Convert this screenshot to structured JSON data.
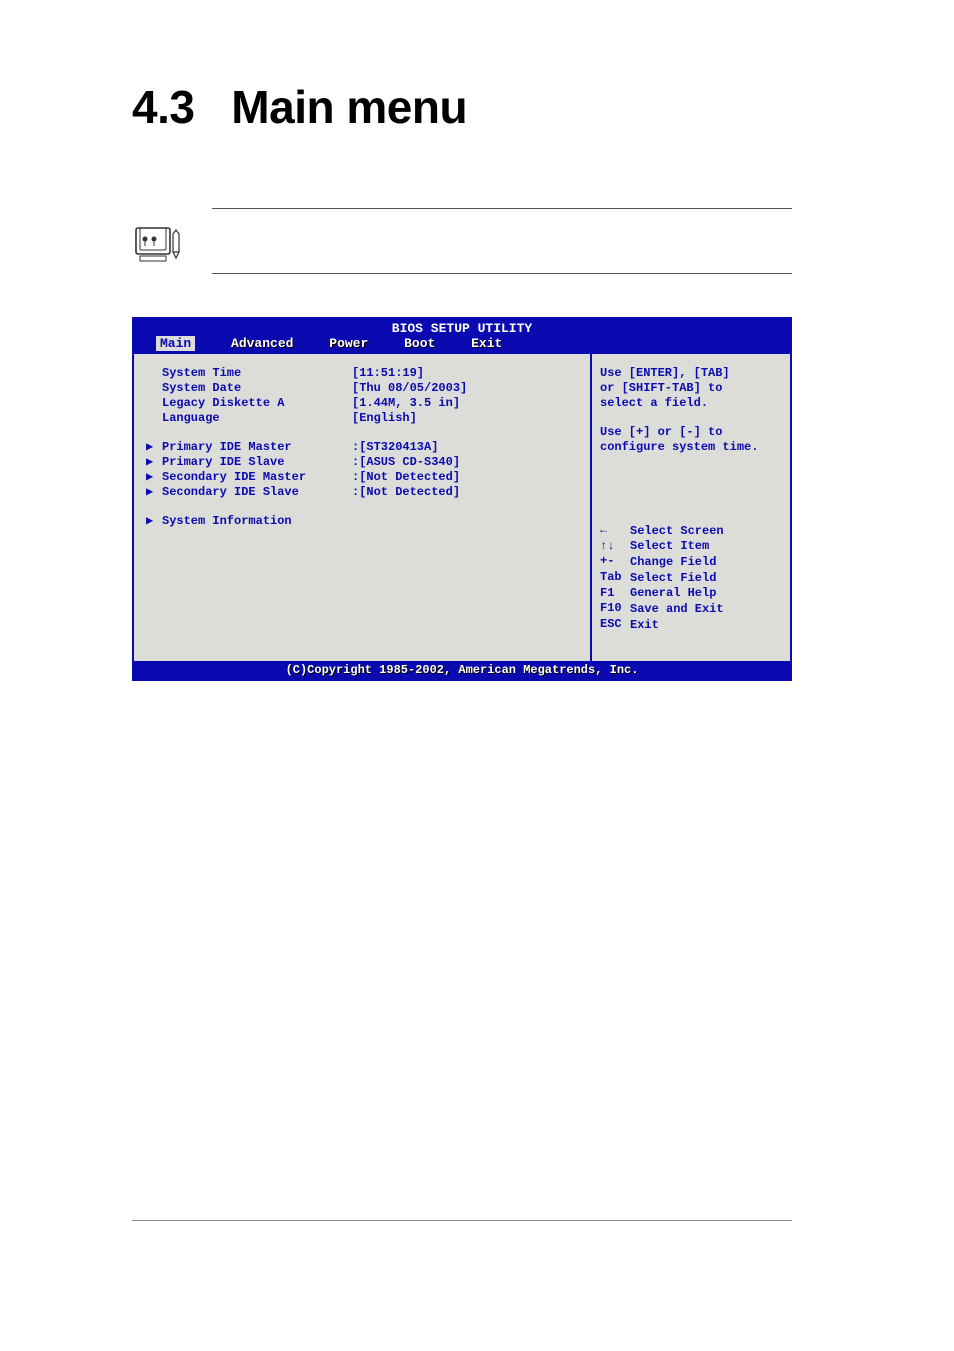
{
  "page": {
    "section_number": "4.3",
    "section_title": "Main menu"
  },
  "bios": {
    "title": "BIOS SETUP UTILITY",
    "tabs": [
      "Main",
      "Advanced",
      "Power",
      "Boot",
      "Exit"
    ],
    "selected_tab_index": 0,
    "fields": {
      "system_time": {
        "label": "System Time",
        "value": "[11:51:19]"
      },
      "system_date": {
        "label": "System Date",
        "value": "[Thu 08/05/2003]"
      },
      "legacy_diskette": {
        "label": "Legacy Diskette A",
        "value": "[1.44M, 3.5 in]"
      },
      "language": {
        "label": "Language",
        "value": "[English]"
      }
    },
    "submenus": {
      "primary_master": {
        "label": "Primary IDE Master",
        "value": ":[ST320413A]"
      },
      "primary_slave": {
        "label": "Primary IDE Slave",
        "value": ":[ASUS CD-S340]"
      },
      "secondary_master": {
        "label": "Secondary IDE Master",
        "value": ":[Not Detected]"
      },
      "secondary_slave": {
        "label": "Secondary IDE Slave",
        "value": ":[Not Detected]"
      },
      "system_info": {
        "label": "System Information",
        "value": ""
      }
    },
    "help": {
      "context1": "Use [ENTER], [TAB]",
      "context2": "or [SHIFT-TAB] to",
      "context3": "select a field.",
      "context4": "Use [+] or [-] to",
      "context5": "configure system time.",
      "nav": [
        {
          "key": "←→",
          "text": "Select Screen",
          "icon": "arrows-lr"
        },
        {
          "key": "↑↓",
          "text": "Select Item",
          "icon": "arrows-ud"
        },
        {
          "key": "+-",
          "text": "Change Field",
          "icon": "plus-minus"
        },
        {
          "key": "Tab",
          "text": "Select Field",
          "icon": "tab"
        },
        {
          "key": "F1",
          "text": "General Help",
          "icon": "f1"
        },
        {
          "key": "F10",
          "text": "Save and Exit",
          "icon": "f10"
        },
        {
          "key": "ESC",
          "text": "Exit",
          "icon": "esc"
        }
      ]
    },
    "copyright": "(C)Copyright 1985-2002, American Megatrends, Inc."
  }
}
